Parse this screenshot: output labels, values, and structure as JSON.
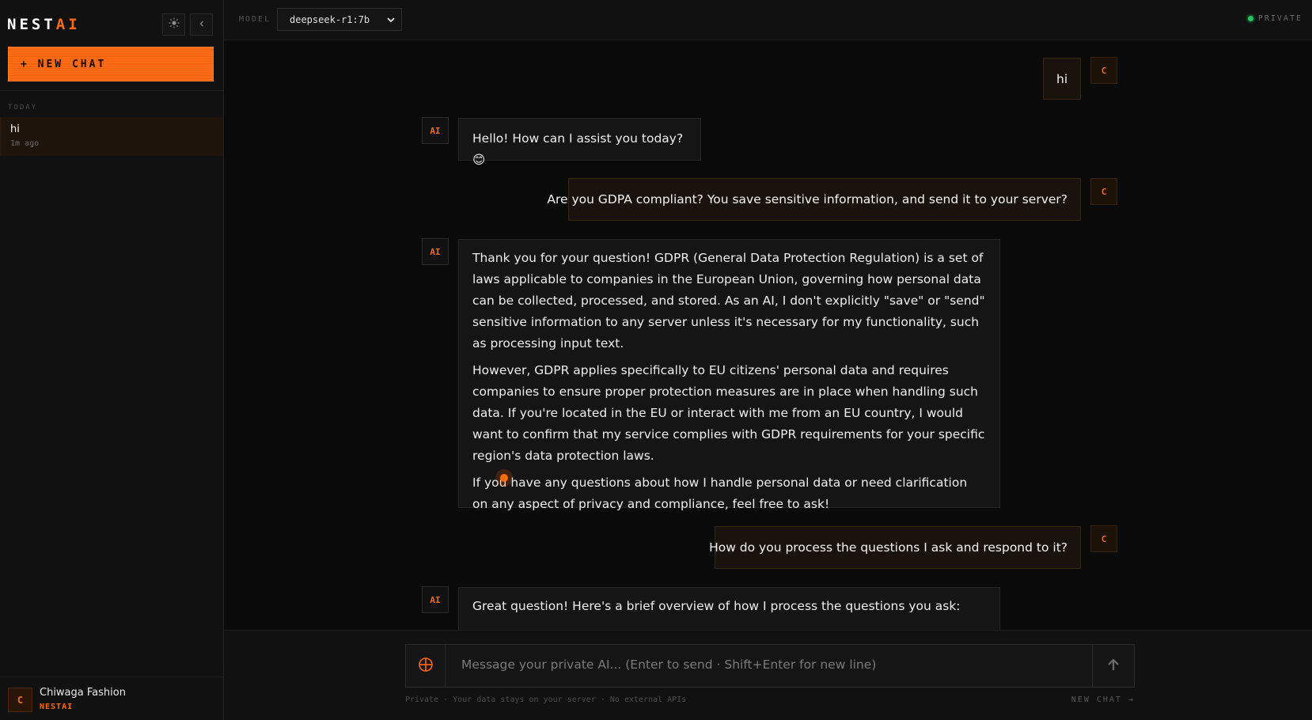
{
  "brand": {
    "name_main": "NEST",
    "name_accent": "AI"
  },
  "sidebar": {
    "theme_icon": "sun-icon",
    "collapse_icon": "chevron-left-icon",
    "new_chat_label": "+ NEW CHAT",
    "section_label": "TODAY",
    "history": [
      {
        "title": "hi",
        "time": "1m ago"
      }
    ],
    "user": {
      "initial": "C",
      "name": "Chiwaga Fashion",
      "org": "NESTAI"
    }
  },
  "topbar": {
    "model_label": "MODEL",
    "model_value": "deepseek-r1:7b",
    "status_label": "PRIVATE"
  },
  "messages": [
    {
      "role": "user",
      "avatar": "C",
      "text": "hi"
    },
    {
      "role": "ai",
      "avatar": "AI",
      "paragraphs": [
        "Hello! How can I assist you today? 😊"
      ]
    },
    {
      "role": "user",
      "avatar": "C",
      "text": "Are you GDPA compliant? You save sensitive information, and send it to your server?"
    },
    {
      "role": "ai",
      "avatar": "AI",
      "paragraphs": [
        "Thank you for your question! GDPR (General Data Protection Regulation) is a set of laws applicable to companies in the European Union, governing how personal data can be collected, processed, and stored. As an AI, I don't explicitly \"save\" or \"send\" sensitive information to any server unless it's necessary for my functionality, such as processing input text.",
        "However, GDPR applies specifically to EU citizens' personal data and requires companies to ensure proper protection measures are in place when handling such data. If you're located in the EU or interact with me from an EU country, I would want to confirm that my service complies with GDPR requirements for your specific region's data protection laws.",
        "If you have any questions about how I handle personal data or need clarification on any aspect of privacy and compliance, feel free to ask!"
      ]
    },
    {
      "role": "user",
      "avatar": "C",
      "text": "How do you process the questions I ask and respond to it?"
    },
    {
      "role": "ai",
      "avatar": "AI",
      "paragraphs": [
        "Great question! Here's a brief overview of how I process the questions you ask:"
      ]
    }
  ],
  "composer": {
    "attach_icon": "crosshair-icon",
    "placeholder": "Message your private AI... (Enter to send · Shift+Enter for new line)",
    "send_icon": "arrow-up-icon",
    "footer_note": "Private · Your data stays on your server · No external APIs",
    "footer_link": "NEW CHAT →"
  },
  "colors": {
    "accent": "#ff6a13",
    "status_green": "#22c55e",
    "background": "#0a0a0a"
  }
}
